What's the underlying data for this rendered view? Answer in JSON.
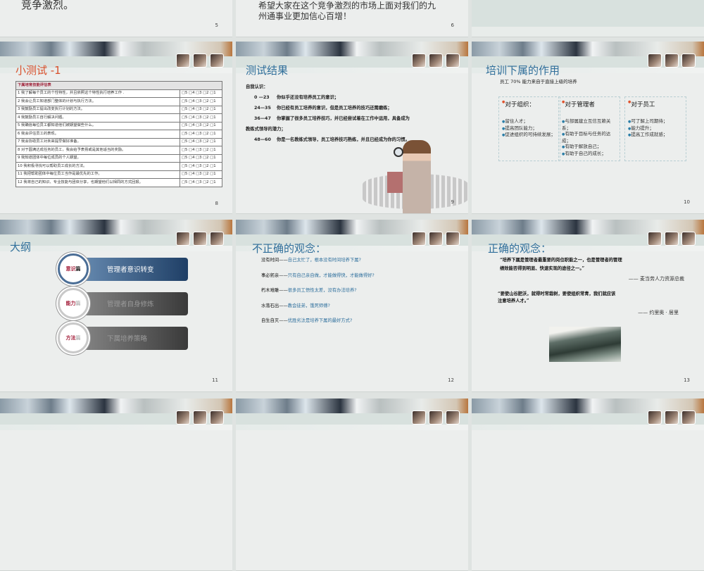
{
  "slides": {
    "s5": {
      "text": "竞争激烈。",
      "num": "5"
    },
    "s6": {
      "line1": "希望大家在这个竞争激烈的市场上面对我们的九",
      "line2": "州通事业更加信心百增！",
      "num": "6"
    },
    "s8": {
      "title": "小测试 -1",
      "table_title": "下属培育技能评估表",
      "options": "□5 □4 □3 □2 □1",
      "num": "8",
      "rows": [
        "1  我了解每个员工的个性特性，并且依照这个特性执行培养工作 .",
        "2  我会让员工知道部门整体的计划与执行方法。",
        "3  我鼓励员工提出改变执行计划的方法。",
        "4  我鼓励员工自行解决问题。",
        "5  我确信每位员工都知道他们被期望做些什么。",
        "6  我会评估员工的表现。",
        "7  我会协助员工对未来提早做好准备。",
        "8  对于圆满达成任务的员工，我会给予表扬或是其他适当的奖励。",
        "9  我知道团体中每位成员的个人期望。",
        "10  我积极寻找可以帮助员工成长的方法。",
        "11  我把帮助团体中每位员工当作是最优先的工作。",
        "12  我将自己的知识、专业技能与团体分享，也期望他们以相同的方式回报。"
      ]
    },
    "s9": {
      "title": "测试结果",
      "label": "自我认识：",
      "num": "9",
      "items": [
        {
          "range": "0 —23",
          "text": "你似乎还没有培养员工的意识；"
        },
        {
          "range": "24—35",
          "text": "你已经有员工培养的意识，但是员工培养的技巧还需磨练；"
        },
        {
          "range": "36—47",
          "text": "你掌握了很多员工培养技巧，并已经尝试着在工作中运用，具备成为"
        },
        {
          "range": "",
          "text": "教练式领导的潜力；"
        },
        {
          "range": "48—60",
          "text": "你是一名教练式领导，员工培养技巧熟练，并且已经成为你的习惯。"
        }
      ]
    },
    "s10": {
      "title": "培训下属的作用",
      "subtitle": "员工 70% 能力来自于直接上级的培养",
      "num": "10",
      "boxes": [
        {
          "head": "对于组织：",
          "items": [
            "留住人才；",
            "提高团队能力；",
            "促进组织的可持续发展；"
          ]
        },
        {
          "head": "对于管理者",
          "items": [
            "与部属建立互信互赖关系；",
            "有助于目标与任务的达成；",
            "有助于解放自己；",
            "有助于自己的成长；"
          ]
        },
        {
          "head": "对于员工",
          "items": [
            "可了解上司期待；",
            "能力提升；",
            "提高工作成就感；"
          ]
        }
      ]
    },
    "s11": {
      "title": "大纲",
      "num": "11",
      "items": [
        {
          "tag": "意识",
          "suffix": "篇",
          "label": "管理者意识转变"
        },
        {
          "tag": "能力",
          "suffix": "篇",
          "label": "管理者自身修炼"
        },
        {
          "tag": "方法",
          "suffix": "篇",
          "label": "下属培养策略"
        }
      ]
    },
    "s12": {
      "title": "不正确的观念：",
      "num": "12",
      "items": [
        {
          "k": "没有时间——",
          "v": "自己太忙了，根本没有时间培养下属?"
        },
        {
          "k": "事必躬亲——",
          "v": "只有自己亲自做，才能做得快，才能做得好?"
        },
        {
          "k": "朽木难雕——",
          "v": "很多员工悟性太差，没有办法培养?"
        },
        {
          "k": "水落石出——",
          "v": "教会徒弟，饿死师傅?"
        },
        {
          "k": "自生自灭——",
          "v": "优胜劣汰是培养下属的最好方式?"
        }
      ]
    },
    "s13": {
      "title": "正确的观念：",
      "num": "13",
      "q1a": "“培养下属是管理者最重要的岗位职能之一，也是管理者的管理",
      "q1b": "绩效能否得到明显、快速实现的途径之一。”",
      "a1": "—— 麦当劳人力资源总裁",
      "q2a": "“要使山谷肥沃，就得时常栽树，要使组织常青，我们就应该",
      "q2b": "注意培养人才。”",
      "a2": "—— 约里奥 · 居里"
    }
  },
  "colors": {
    "title_blue": "#2f6e9a",
    "title_red": "#d9502c",
    "accent_red": "#a31e3a"
  }
}
